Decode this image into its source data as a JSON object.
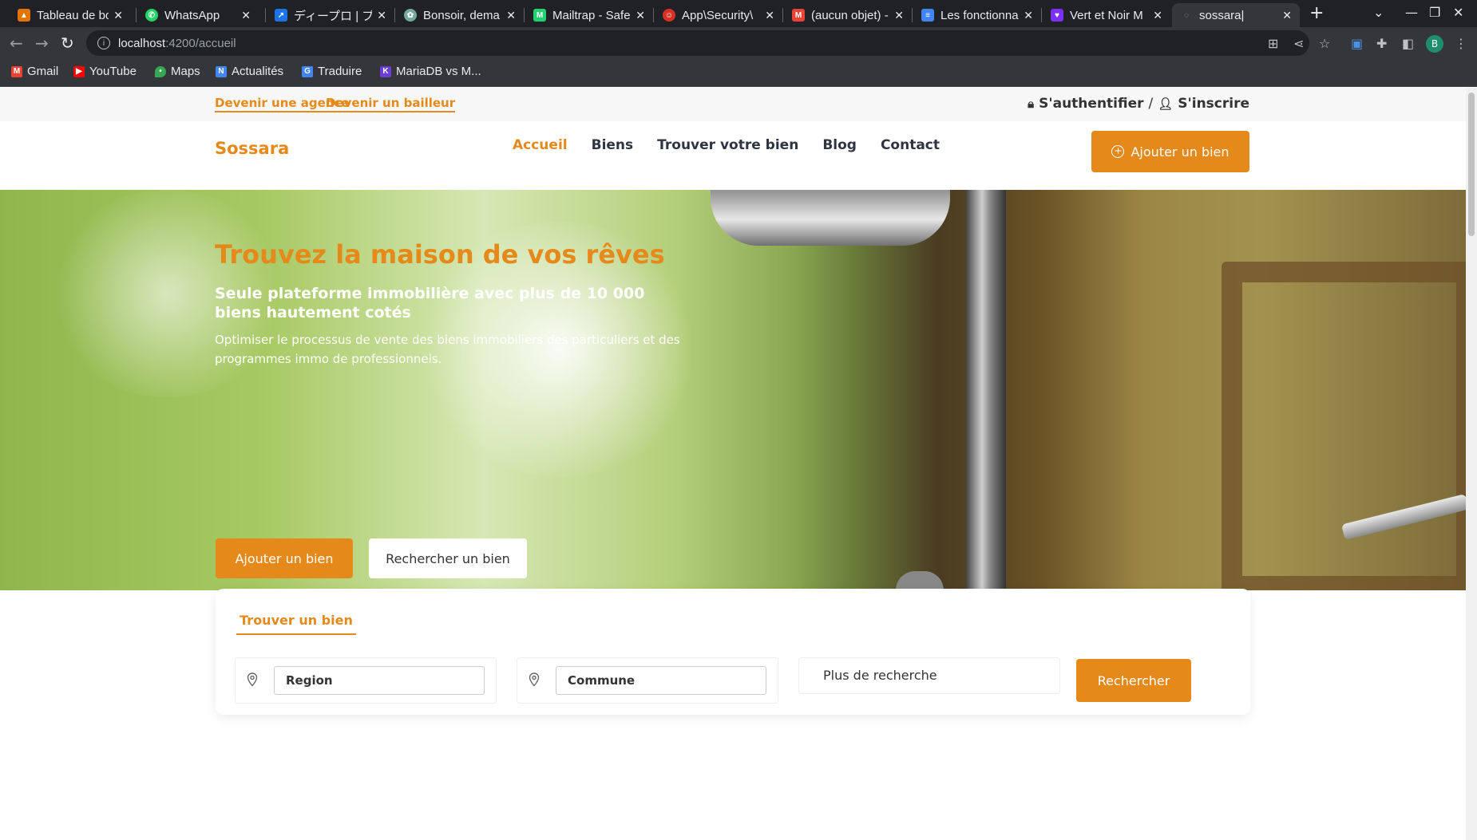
{
  "browser": {
    "tabs": [
      {
        "title": "Tableau de bo",
        "icon": "flame-icon",
        "color": "#e37400"
      },
      {
        "title": "WhatsApp",
        "icon": "whatsapp-icon",
        "color": "#25d366"
      },
      {
        "title": "ディープロ | プ",
        "icon": "pin-icon",
        "color": "#1a73e8"
      },
      {
        "title": "Bonsoir, dema",
        "icon": "chatgpt-icon",
        "color": "#74aa9c"
      },
      {
        "title": "Mailtrap - Safe",
        "icon": "mailtrap-icon",
        "color": "#22d172"
      },
      {
        "title": "App\\Security\\",
        "icon": "symfony-icon",
        "color": "#d93025"
      },
      {
        "title": "(aucun objet) -",
        "icon": "gmail-icon",
        "color": "#ea4335"
      },
      {
        "title": "Les fonctionna",
        "icon": "docs-icon",
        "color": "#4285f4"
      },
      {
        "title": "Vert et Noir M",
        "icon": "canva-icon",
        "color": "#7b2ff7"
      },
      {
        "title": "sossara|",
        "icon": "loading-icon",
        "color": "#9aa0a6"
      }
    ],
    "address": {
      "host": "localhost",
      "path": ":4200/accueil"
    },
    "profile_initial": "B",
    "bookmarks": [
      {
        "label": "Gmail",
        "color": "#ea4335"
      },
      {
        "label": "YouTube",
        "color": "#ff0000"
      },
      {
        "label": "Maps",
        "color": "#34a853"
      },
      {
        "label": "Actualités",
        "color": "#4285f4"
      },
      {
        "label": "Traduire",
        "color": "#4285f4"
      },
      {
        "label": "MariaDB vs M...",
        "color": "#6b3fd4"
      }
    ]
  },
  "site": {
    "toplinks": {
      "agency": "Devenir une agence",
      "landlord": "Devenir un bailleur"
    },
    "auth": {
      "login": "S'authentifier",
      "separator": "/",
      "register": "S'inscrire"
    },
    "logo": "Sossara",
    "nav": [
      "Accueil",
      "Biens",
      "Trouver votre bien",
      "Blog",
      "Contact"
    ],
    "nav_add_button": "Ajouter un bien",
    "hero": {
      "title": "Trouvez la maison de vos rêves",
      "subtitle": "Seule plateforme immobilière avec plus de 10 000 biens hautement cotés",
      "description": "Optimiser le processus de vente des biens immobiliers des particuliers et des programmes immo de professionnels.",
      "primary_button": "Ajouter un bien",
      "secondary_button": "Rechercher un bien"
    },
    "search": {
      "tab": "Trouver un bien",
      "region_placeholder": "Region",
      "commune_placeholder": "Commune",
      "more": "Plus de recherche",
      "submit": "Rechercher"
    },
    "accent_color": "#e6891b"
  }
}
